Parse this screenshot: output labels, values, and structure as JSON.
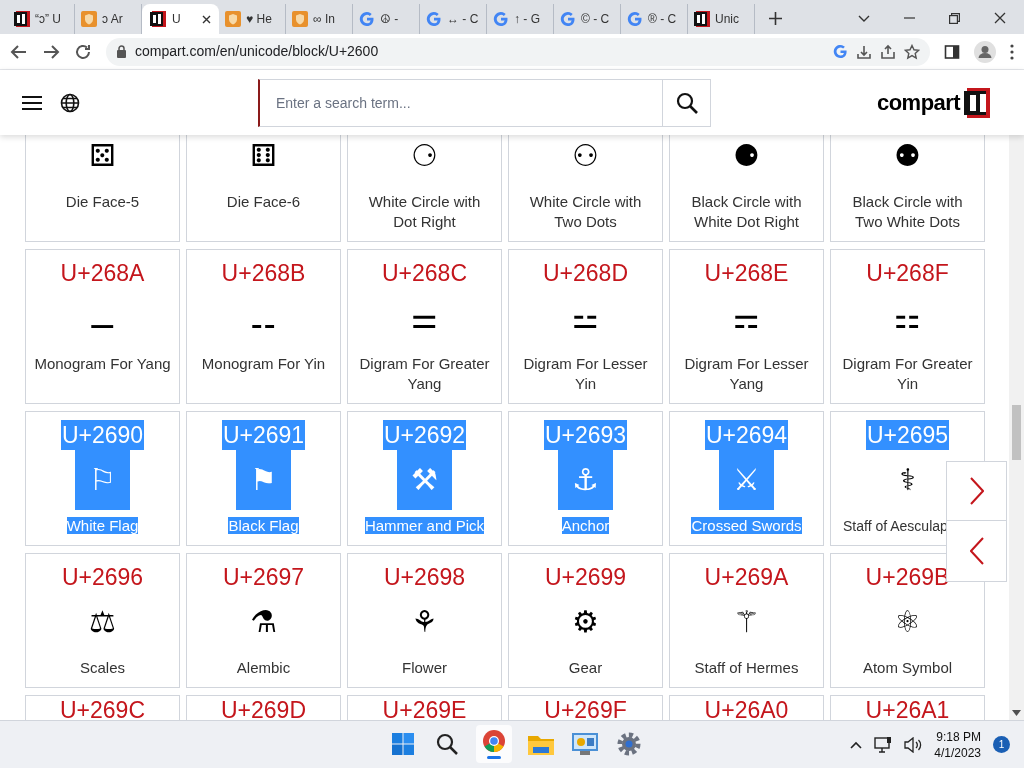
{
  "browser": {
    "tabs": [
      {
        "title": "“ↄ” U",
        "kind": "site",
        "selected": false
      },
      {
        "title": "ↄ Ar",
        "kind": "extension",
        "selected": false
      },
      {
        "title": "U",
        "kind": "site",
        "selected": true
      },
      {
        "title": "♥ He",
        "kind": "extension",
        "selected": false
      },
      {
        "title": "∞ In",
        "kind": "extension",
        "selected": false
      },
      {
        "title": "☮ -",
        "kind": "search",
        "selected": false
      },
      {
        "title": "↔ - C",
        "kind": "search",
        "selected": false
      },
      {
        "title": "↑ - G",
        "kind": "search",
        "selected": false
      },
      {
        "title": "© - C",
        "kind": "search",
        "selected": false
      },
      {
        "title": "® - C",
        "kind": "search",
        "selected": false
      },
      {
        "title": "Unic",
        "kind": "site",
        "selected": false
      }
    ],
    "url": "compart.com/en/unicode/block/U+2600"
  },
  "site": {
    "search": {
      "placeholder": "Enter a search term..."
    },
    "logo": "compart"
  },
  "grid": {
    "rows": [
      [
        {
          "glyph": "⚄",
          "name": "Die Face-5"
        },
        {
          "glyph": "⚅",
          "name": "Die Face-6"
        },
        {
          "glyph": "⚆",
          "name": "White Circle with Dot Right"
        },
        {
          "glyph": "⚇",
          "name": "White Circle with Two Dots"
        },
        {
          "glyph": "⚈",
          "name": "Black Circle with White Dot Right"
        },
        {
          "glyph": "⚉",
          "name": "Black Circle with Two White Dots"
        }
      ],
      [
        {
          "code": "U+268A",
          "glyph": "⚊",
          "name": "Monogram For Yang"
        },
        {
          "code": "U+268B",
          "glyph": "⚋",
          "name": "Monogram For Yin"
        },
        {
          "code": "U+268C",
          "glyph": "⚌",
          "name": "Digram For Greater Yang"
        },
        {
          "code": "U+268D",
          "glyph": "⚍",
          "name": "Digram For Lesser Yin"
        },
        {
          "code": "U+268E",
          "glyph": "⚎",
          "name": "Digram For Lesser Yang"
        },
        {
          "code": "U+268F",
          "glyph": "⚏",
          "name": "Digram For Greater Yin"
        }
      ],
      [
        {
          "code": "U+2690",
          "glyph": "⚐",
          "name": "White Flag",
          "selected": true
        },
        {
          "code": "U+2691",
          "glyph": "⚑",
          "name": "Black Flag",
          "selected": true
        },
        {
          "code": "U+2692",
          "glyph": "⚒",
          "name": "Hammer and Pick",
          "selected": true
        },
        {
          "code": "U+2693",
          "glyph": "⚓",
          "name": "Anchor",
          "selected": true
        },
        {
          "code": "U+2694",
          "glyph": "⚔",
          "name": "Crossed Swords",
          "selected": true
        },
        {
          "code": "U+2695",
          "glyph": "⚕",
          "name": "Staff of Aesculap",
          "selected": false,
          "code_selected": true,
          "clipped": true
        }
      ],
      [
        {
          "code": "U+2696",
          "glyph": "⚖",
          "name": "Scales"
        },
        {
          "code": "U+2697",
          "glyph": "⚗",
          "name": "Alembic"
        },
        {
          "code": "U+2698",
          "glyph": "⚘",
          "name": "Flower"
        },
        {
          "code": "U+2699",
          "glyph": "⚙",
          "name": "Gear"
        },
        {
          "code": "U+269A",
          "glyph": "⚚",
          "name": "Staff of Hermes"
        },
        {
          "code": "U+269B",
          "glyph": "⚛",
          "name": "Atom Symbol"
        }
      ],
      [
        {
          "code": "U+269C"
        },
        {
          "code": "U+269D"
        },
        {
          "code": "U+269E"
        },
        {
          "code": "U+269F"
        },
        {
          "code": "U+26A0"
        },
        {
          "code": "U+26A1"
        }
      ]
    ]
  },
  "taskbar": {
    "time": "9:18 PM",
    "date": "4/1/2023",
    "notifications": "1"
  }
}
